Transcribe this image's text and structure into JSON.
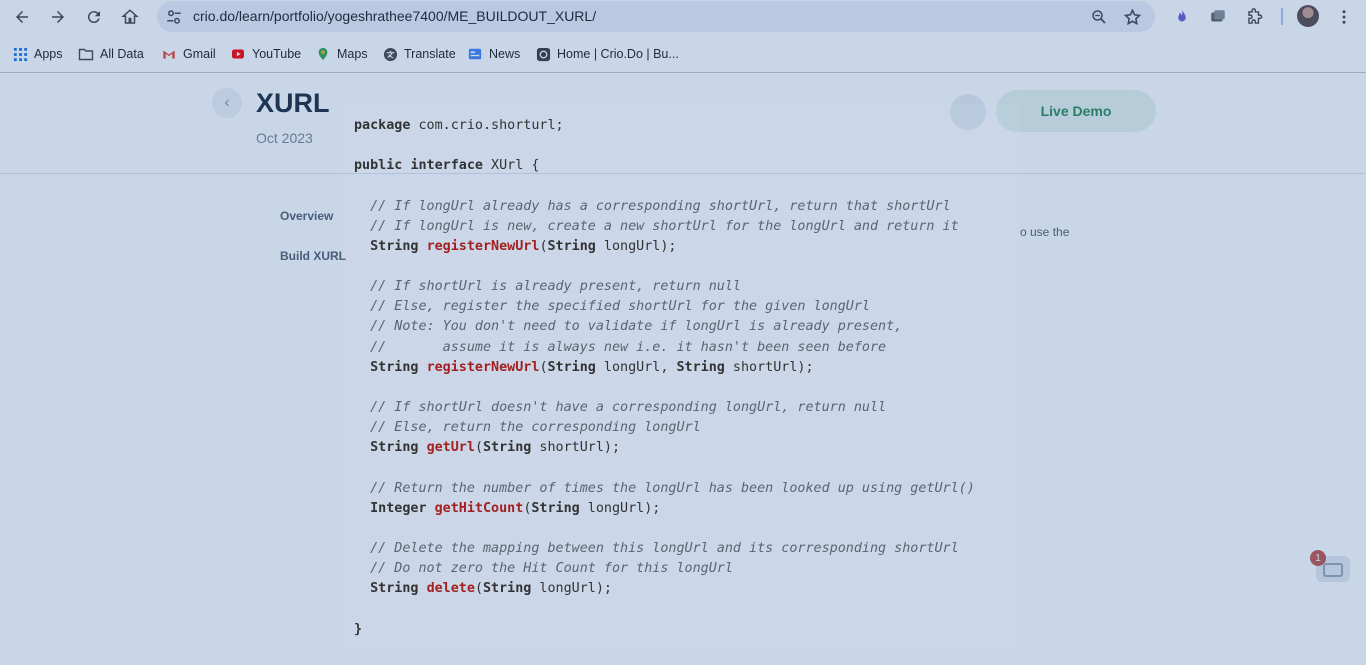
{
  "browser": {
    "url": "crio.do/learn/portfolio/yogeshrathee7400/ME_BUILDOUT_XURL/",
    "bookmarks": [
      {
        "label": "Apps",
        "icon": "apps-grid-icon"
      },
      {
        "label": "All Data",
        "icon": "folder-icon"
      },
      {
        "label": "Gmail",
        "icon": "gmail-icon"
      },
      {
        "label": "YouTube",
        "icon": "youtube-icon"
      },
      {
        "label": "Maps",
        "icon": "maps-pin-icon"
      },
      {
        "label": "Translate",
        "icon": "translate-icon"
      },
      {
        "label": "News",
        "icon": "news-icon"
      },
      {
        "label": "Home | Crio.Do | Bu...",
        "icon": "crio-icon"
      }
    ]
  },
  "page": {
    "title": "XURL",
    "date": "Oct 2023",
    "live_demo_label": "Live Demo",
    "sidebar": [
      "Overview",
      "Build XURL"
    ],
    "paragraph_tail": "o use the",
    "chat_badge_count": "1"
  },
  "code_modal": {
    "lines": [
      [
        {
          "t": "package",
          "c": "kw"
        },
        {
          "t": " com.crio.shorturl;",
          "c": ""
        }
      ],
      [],
      [
        {
          "t": "public",
          "c": "kw"
        },
        {
          "t": " ",
          "c": ""
        },
        {
          "t": "interface",
          "c": "kw"
        },
        {
          "t": " XUrl {",
          "c": ""
        }
      ],
      [],
      [
        {
          "t": "  // If longUrl already has a corresponding shortUrl, return that shortUrl",
          "c": "cm"
        }
      ],
      [
        {
          "t": "  // If longUrl is new, create a new shortUrl for the longUrl and return it",
          "c": "cm"
        }
      ],
      [
        {
          "t": "  ",
          "c": ""
        },
        {
          "t": "String",
          "c": "ty"
        },
        {
          "t": " ",
          "c": ""
        },
        {
          "t": "registerNewUrl",
          "c": "fn"
        },
        {
          "t": "(",
          "c": ""
        },
        {
          "t": "String",
          "c": "ty"
        },
        {
          "t": " longUrl);",
          "c": ""
        }
      ],
      [],
      [
        {
          "t": "  // If shortUrl is already present, return null",
          "c": "cm"
        }
      ],
      [
        {
          "t": "  // Else, register the specified shortUrl for the given longUrl",
          "c": "cm"
        }
      ],
      [
        {
          "t": "  // Note: You don't need to validate if longUrl is already present,",
          "c": "cm"
        }
      ],
      [
        {
          "t": "  //       assume it is always new i.e. it hasn't been seen before",
          "c": "cm"
        }
      ],
      [
        {
          "t": "  ",
          "c": ""
        },
        {
          "t": "String",
          "c": "ty"
        },
        {
          "t": " ",
          "c": ""
        },
        {
          "t": "registerNewUrl",
          "c": "fn"
        },
        {
          "t": "(",
          "c": ""
        },
        {
          "t": "String",
          "c": "ty"
        },
        {
          "t": " longUrl, ",
          "c": ""
        },
        {
          "t": "String",
          "c": "ty"
        },
        {
          "t": " shortUrl);",
          "c": ""
        }
      ],
      [],
      [
        {
          "t": "  // If shortUrl doesn't have a corresponding longUrl, return null",
          "c": "cm"
        }
      ],
      [
        {
          "t": "  // Else, return the corresponding longUrl",
          "c": "cm"
        }
      ],
      [
        {
          "t": "  ",
          "c": ""
        },
        {
          "t": "String",
          "c": "ty"
        },
        {
          "t": " ",
          "c": ""
        },
        {
          "t": "getUrl",
          "c": "fn"
        },
        {
          "t": "(",
          "c": ""
        },
        {
          "t": "String",
          "c": "ty"
        },
        {
          "t": " shortUrl);",
          "c": ""
        }
      ],
      [],
      [
        {
          "t": "  // Return the number of times the longUrl has been looked up using getUrl()",
          "c": "cm"
        }
      ],
      [
        {
          "t": "  ",
          "c": ""
        },
        {
          "t": "Integer",
          "c": "ty"
        },
        {
          "t": " ",
          "c": ""
        },
        {
          "t": "getHitCount",
          "c": "fn"
        },
        {
          "t": "(",
          "c": ""
        },
        {
          "t": "String",
          "c": "ty"
        },
        {
          "t": " longUrl);",
          "c": ""
        }
      ],
      [],
      [
        {
          "t": "  // Delete the mapping between this longUrl and its corresponding shortUrl",
          "c": "cm"
        }
      ],
      [
        {
          "t": "  // Do not zero the Hit Count for this longUrl",
          "c": "cm"
        }
      ],
      [
        {
          "t": "  ",
          "c": ""
        },
        {
          "t": "String",
          "c": "ty"
        },
        {
          "t": " ",
          "c": ""
        },
        {
          "t": "delete",
          "c": "fn"
        },
        {
          "t": "(",
          "c": ""
        },
        {
          "t": "String",
          "c": "ty"
        },
        {
          "t": " longUrl);",
          "c": ""
        }
      ],
      [],
      [
        {
          "t": "}",
          "c": "kw"
        }
      ]
    ]
  }
}
